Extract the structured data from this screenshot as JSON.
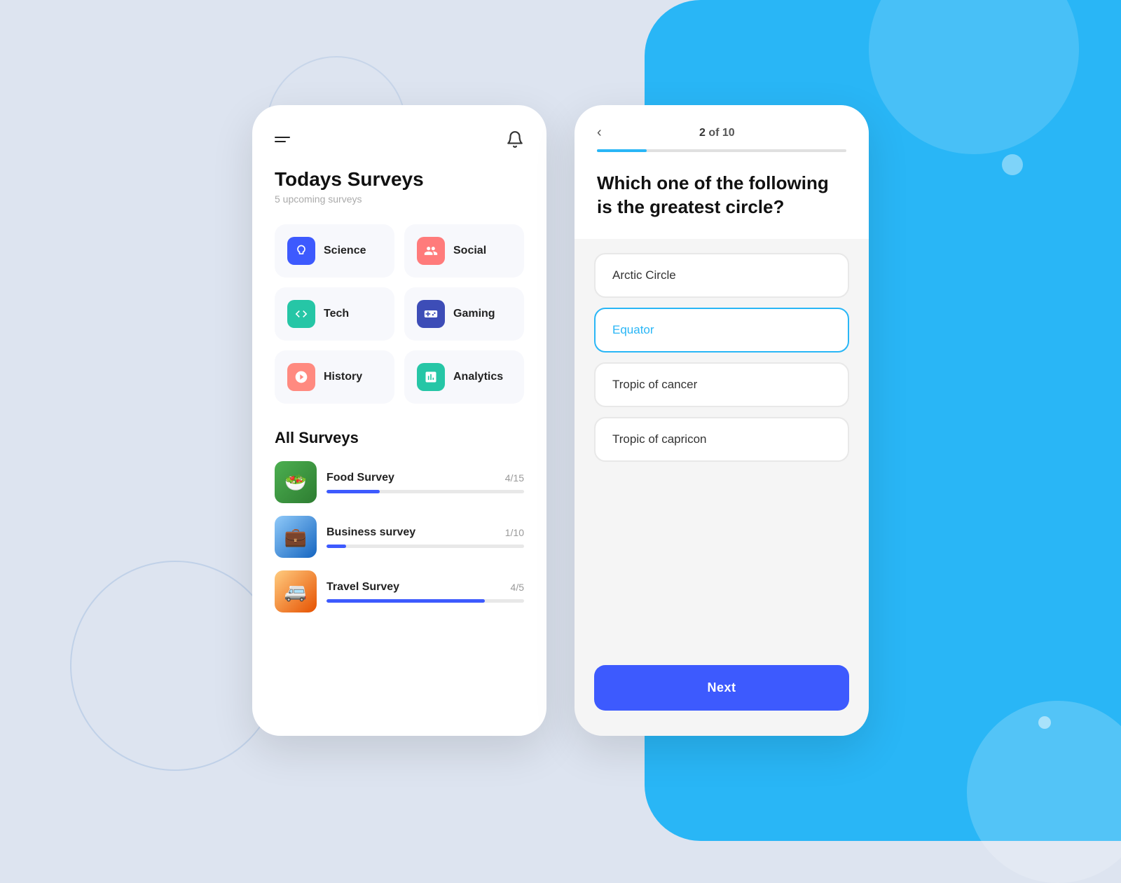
{
  "background": {
    "blue_color": "#29b6f6"
  },
  "left_phone": {
    "title": "Todays Surveys",
    "subtitle": "5 upcoming surveys",
    "categories": [
      {
        "id": "science",
        "label": "Science",
        "color_class": "science",
        "icon": "🧬"
      },
      {
        "id": "social",
        "label": "Social",
        "color_class": "social",
        "icon": "👤"
      },
      {
        "id": "tech",
        "label": "Tech",
        "color_class": "tech",
        "icon": "🧪"
      },
      {
        "id": "gaming",
        "label": "Gaming",
        "color_class": "gaming",
        "icon": "🎮"
      },
      {
        "id": "history",
        "label": "History",
        "color_class": "history",
        "icon": "⚖️"
      },
      {
        "id": "analytics",
        "label": "Analytics",
        "color_class": "analytics",
        "icon": "📊"
      }
    ],
    "all_surveys_title": "All Surveys",
    "surveys": [
      {
        "id": "food",
        "name": "Food Survey",
        "count": "4/15",
        "progress": 27,
        "thumb_class": "food",
        "icon": "🥗"
      },
      {
        "id": "business",
        "name": "Business survey",
        "count": "1/10",
        "progress": 10,
        "thumb_class": "business",
        "icon": "💼"
      },
      {
        "id": "travel",
        "name": "Travel Survey",
        "count": "4/5",
        "progress": 80,
        "thumb_class": "travel",
        "icon": "🚐"
      }
    ]
  },
  "right_phone": {
    "back_label": "‹",
    "progress_current": "2",
    "progress_total": "10",
    "progress_of": "of",
    "question": "Which one of the following is the greatest circle?",
    "options": [
      {
        "id": "arctic",
        "label": "Arctic Circle",
        "selected": false
      },
      {
        "id": "equator",
        "label": "Equator",
        "selected": true
      },
      {
        "id": "tropic_cancer",
        "label": "Tropic of cancer",
        "selected": false
      },
      {
        "id": "tropic_capricorn",
        "label": "Tropic of capricon",
        "selected": false
      }
    ],
    "next_label": "Next"
  }
}
